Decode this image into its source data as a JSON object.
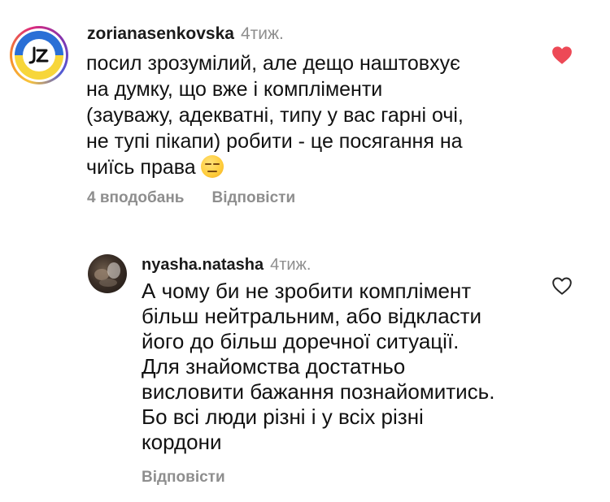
{
  "comments": [
    {
      "username": "zorianasenkovska",
      "time": "4тиж.",
      "lines": [
        "посил зрозумілий, але дещо наштовхує",
        "на думку, що вже і компліменти",
        "(зауважу, адекватні, типу у вас гарні очі,",
        "не тупі пікапи) робити - це посягання на",
        "чиїсь права"
      ],
      "emoji": "expressionless-face-emoji",
      "likes": "4 вподобань",
      "reply": "Відповісти",
      "liked": true,
      "heart_color": "#ed4956",
      "avatar_logo": "JZ"
    },
    {
      "username": "nyasha.natasha",
      "time": "4тиж.",
      "lines": [
        "А чому би не зробити комплімент",
        "більш нейтральним, або відкласти",
        "його до більш доречної ситуації.",
        "Для знайомства достатньо",
        "висловити бажання познайомитись.",
        "Бо всі люди різні і у всіх різні",
        "кордони"
      ],
      "reply": "Відповісти",
      "liked": false,
      "heart_color": "#262626"
    }
  ],
  "colors": {
    "meta_gray": "#8e8e8e",
    "text": "#111111"
  }
}
